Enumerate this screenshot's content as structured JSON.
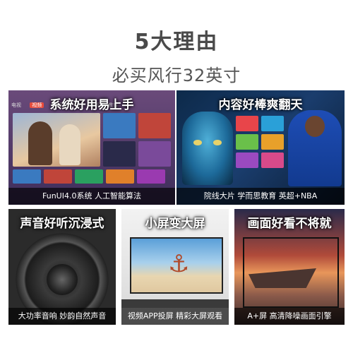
{
  "header": {
    "title": "5大理由",
    "subtitle": "必买风行32英寸"
  },
  "panels": [
    {
      "title": "系统好用易上手",
      "caption": "FunUI4.0系统 人工智能算法",
      "nav": [
        "电视",
        "视频",
        "影视",
        "少儿",
        "生活",
        "教育"
      ]
    },
    {
      "title": "内容好棒爽翻天",
      "caption": "院线大片 学而思教育 英超+NBA"
    },
    {
      "title": "声音好听沉浸式",
      "caption": "大功率音响 妙韵自然声音"
    },
    {
      "title": "小屏变大屏",
      "caption": "视频APP投屏 精彩大屏观看"
    },
    {
      "title": "画面好看不将就",
      "caption": "A+屏 高清降噪画面引擎"
    }
  ],
  "colors": {
    "title_text": "#4a4a4a",
    "accent_red": "#e84c3d"
  }
}
